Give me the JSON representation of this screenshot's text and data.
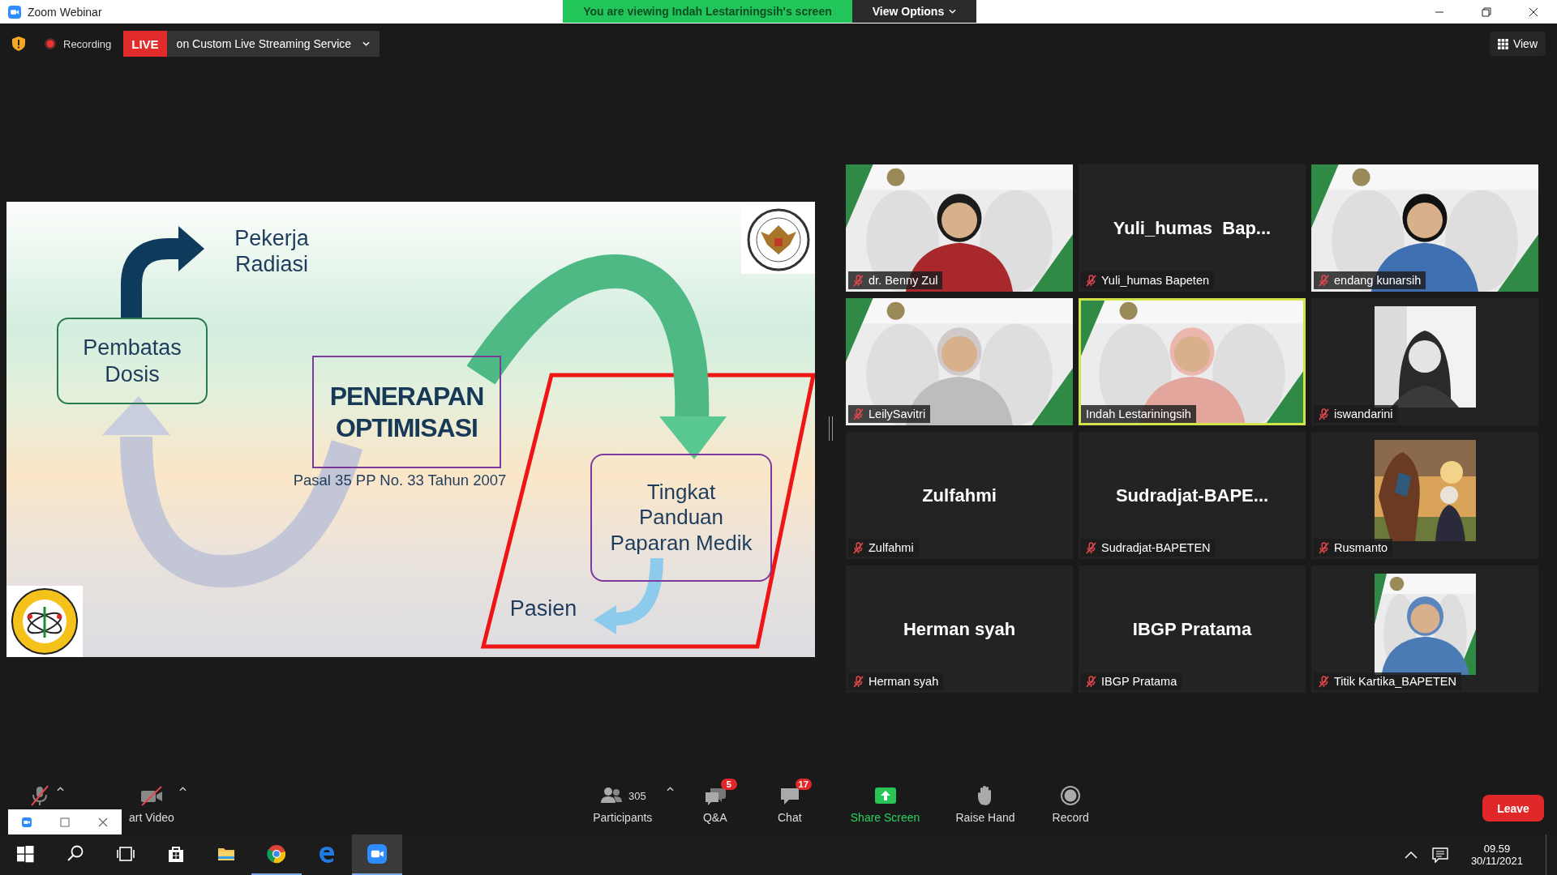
{
  "window": {
    "title": "Zoom Webinar"
  },
  "banner": {
    "text": "You are viewing Indah Lestariningsih's screen",
    "view_options": "View Options"
  },
  "meeting_bar": {
    "recording": "Recording",
    "live_badge": "LIVE",
    "streaming": "on Custom Live Streaming Service",
    "view_button": "View"
  },
  "slide": {
    "worker_label": "Pekerja\nRadiasi",
    "dose_box": "Pembatas\nDosis",
    "center_box": "PENERAPAN\nOPTIMISASI",
    "regulation": "Pasal 35 PP No. 33 Tahun 2007",
    "guidance_box": "Tingkat\nPanduan\nPaparan Medik",
    "patient_label": "Pasien"
  },
  "tiles": [
    {
      "kind": "video",
      "name": "dr. Benny Zul",
      "muted": true,
      "selected": false
    },
    {
      "kind": "name",
      "display_name": "Yuli_humas  Bap...",
      "name": "Yuli_humas Bapeten",
      "muted": true,
      "selected": false
    },
    {
      "kind": "video",
      "name": "endang kunarsih",
      "muted": true,
      "selected": false
    },
    {
      "kind": "video",
      "name": "LeilySavitri",
      "muted": true,
      "selected": false
    },
    {
      "kind": "video",
      "name": "Indah Lestariningsih",
      "muted": false,
      "selected": true
    },
    {
      "kind": "avatar",
      "name": "iswandarini",
      "muted": true,
      "selected": false
    },
    {
      "kind": "name",
      "display_name": "Zulfahmi",
      "name": "Zulfahmi",
      "muted": true,
      "selected": false
    },
    {
      "kind": "name",
      "display_name": "Sudradjat-BAPE...",
      "name": "Sudradjat-BAPETEN",
      "muted": true,
      "selected": false
    },
    {
      "kind": "avatar",
      "name": "Rusmanto",
      "muted": true,
      "selected": false
    },
    {
      "kind": "name",
      "display_name": "Herman syah",
      "name": "Herman syah",
      "muted": true,
      "selected": false
    },
    {
      "kind": "name",
      "display_name": "IBGP Pratama",
      "name": "IBGP Pratama",
      "muted": true,
      "selected": false
    },
    {
      "kind": "avatar",
      "name": "Titik Kartika_BAPETEN",
      "muted": true,
      "selected": false
    }
  ],
  "toolbar": {
    "audio": {
      "muted": true
    },
    "video": {
      "label": "art Video",
      "stopped": true
    },
    "participants": {
      "count": "305",
      "label": "Participants"
    },
    "qa": {
      "label": "Q&A",
      "badge": "5"
    },
    "chat": {
      "label": "Chat",
      "badge": "17"
    },
    "share": {
      "label": "Share Screen"
    },
    "raise_hand": {
      "label": "Raise Hand"
    },
    "record": {
      "label": "Record"
    },
    "leave": {
      "label": "Leave"
    }
  },
  "taskbar": {
    "apps": [
      {
        "kind": "store",
        "running": false,
        "selected": false
      },
      {
        "kind": "folder",
        "running": false,
        "selected": false
      },
      {
        "kind": "browser",
        "running": true,
        "selected": false
      },
      {
        "kind": "edge",
        "running": false,
        "selected": false
      },
      {
        "kind": "zoom",
        "running": true,
        "selected": true
      }
    ],
    "time": "09.59",
    "date": "30/11/2021"
  }
}
